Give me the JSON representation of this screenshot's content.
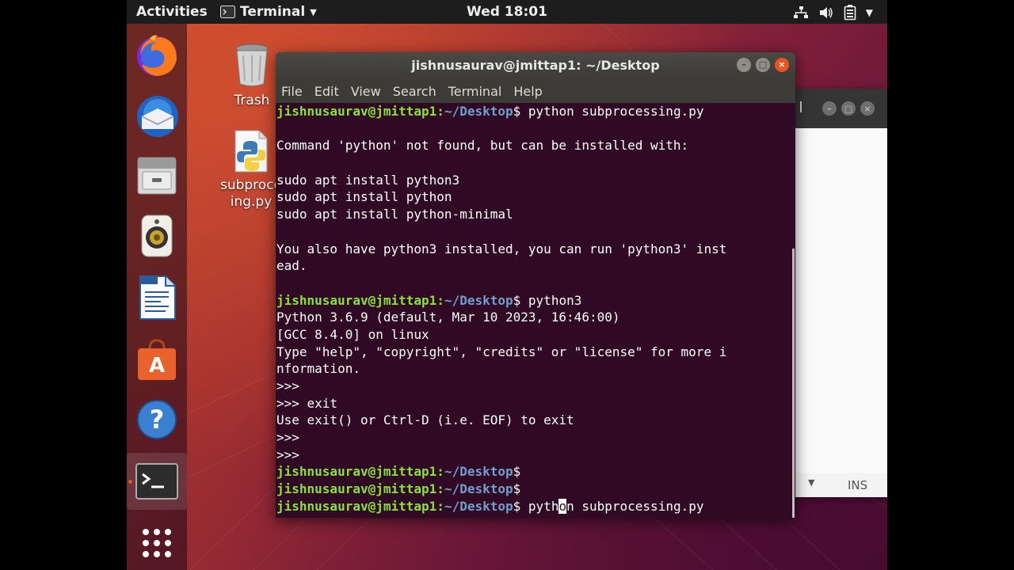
{
  "topbar": {
    "activities": "Activities",
    "app_name": "Terminal",
    "clock": "Wed 18:01",
    "tray_icons": [
      "network-icon",
      "volume-icon",
      "battery-icon",
      "system-menu-icon"
    ]
  },
  "dock": {
    "items": [
      "firefox-icon",
      "thunderbird-icon",
      "files-icon",
      "rhythmbox-icon",
      "writer-icon",
      "software-icon",
      "help-icon",
      "terminal-icon",
      "show-apps-icon"
    ],
    "active": "terminal-icon"
  },
  "desktop": {
    "trash_label": "Trash",
    "file_label_line1": "subproce",
    "file_label_line2": "ing.py"
  },
  "back_window": {
    "status_text": "INS"
  },
  "terminal": {
    "title": "jishnusaurav@jmittap1: ~/Desktop",
    "menu": [
      "File",
      "Edit",
      "View",
      "Search",
      "Terminal",
      "Help"
    ],
    "prompt_user": "jishnusaurav@jmittap1",
    "prompt_sep": ":",
    "prompt_path": "~/Desktop",
    "prompt_dollar": "$",
    "lines": [
      {
        "type": "prompt",
        "cmd": " python subprocessing.py"
      },
      {
        "type": "text",
        "text": ""
      },
      {
        "type": "text",
        "text": "Command 'python' not found, but can be installed with:"
      },
      {
        "type": "text",
        "text": ""
      },
      {
        "type": "text",
        "text": "sudo apt install python3"
      },
      {
        "type": "text",
        "text": "sudo apt install python"
      },
      {
        "type": "text",
        "text": "sudo apt install python-minimal"
      },
      {
        "type": "text",
        "text": ""
      },
      {
        "type": "text",
        "text": "You also have python3 installed, you can run 'python3' inst"
      },
      {
        "type": "text",
        "text": "ead."
      },
      {
        "type": "text",
        "text": ""
      },
      {
        "type": "prompt",
        "cmd": " python3"
      },
      {
        "type": "text",
        "text": "Python 3.6.9 (default, Mar 10 2023, 16:46:00)"
      },
      {
        "type": "text",
        "text": "[GCC 8.4.0] on linux"
      },
      {
        "type": "text",
        "text": "Type \"help\", \"copyright\", \"credits\" or \"license\" for more i"
      },
      {
        "type": "text",
        "text": "nformation."
      },
      {
        "type": "text",
        "text": ">>>"
      },
      {
        "type": "text",
        "text": ">>> exit"
      },
      {
        "type": "text",
        "text": "Use exit() or Ctrl-D (i.e. EOF) to exit"
      },
      {
        "type": "text",
        "text": ">>>"
      },
      {
        "type": "text",
        "text": ">>>"
      },
      {
        "type": "prompt",
        "cmd": ""
      },
      {
        "type": "prompt",
        "cmd": ""
      },
      {
        "type": "prompt",
        "cmd": " pyth",
        "cursor": "o",
        "after": "n subprocessing.py"
      }
    ]
  },
  "colors": {
    "terminal_bg": "#300a24",
    "prompt_user": "#8ae234",
    "prompt_path": "#729fcf",
    "accent": "#e95420"
  }
}
